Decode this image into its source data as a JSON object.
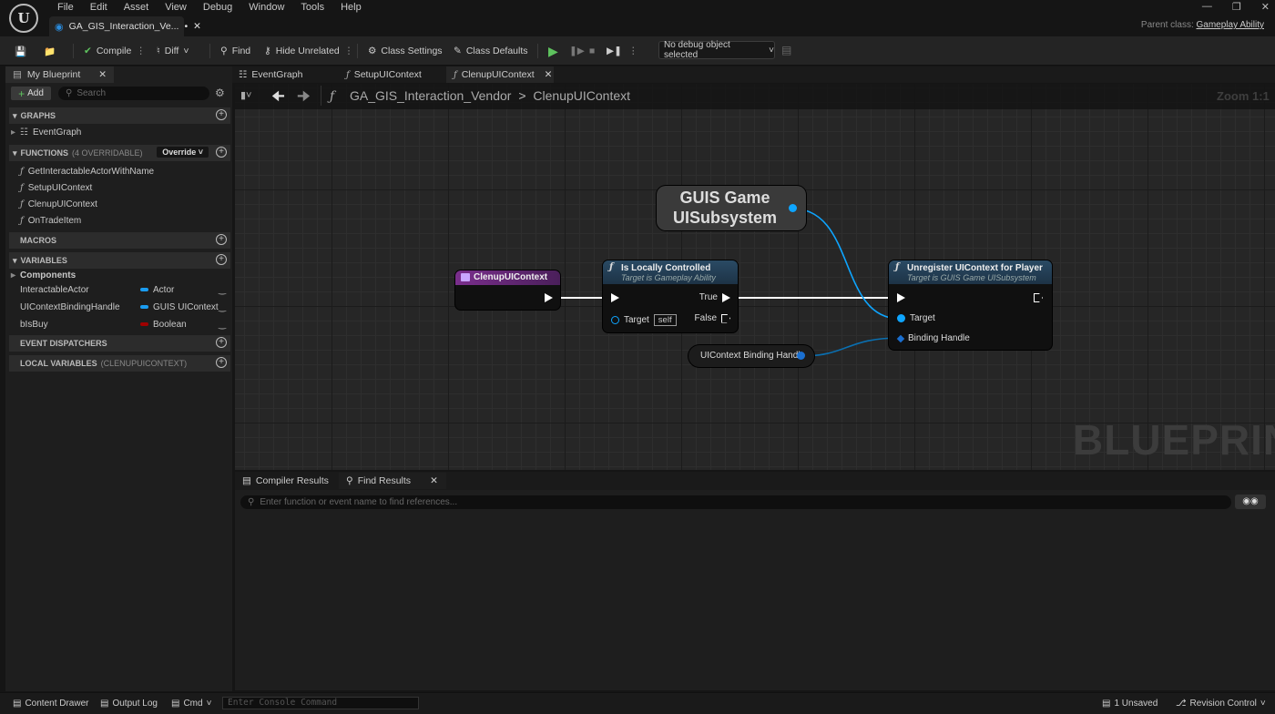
{
  "menu": [
    "File",
    "Edit",
    "Asset",
    "View",
    "Debug",
    "Window",
    "Tools",
    "Help"
  ],
  "doc_tab": "GA_GIS_Interaction_Ve...",
  "doc_tab_mark": "•",
  "parent_class_label": "Parent class:",
  "parent_class_value": "Gameplay Ability",
  "toolbar": {
    "compile": "Compile",
    "diff": "Diff",
    "find": "Find",
    "hide_unrelated": "Hide Unrelated",
    "class_settings": "Class Settings",
    "class_defaults": "Class Defaults",
    "debug_object": "No debug object selected"
  },
  "my_blueprint": {
    "tab": "My Blueprint",
    "add": "Add",
    "search_placeholder": "Search",
    "graphs": "GRAPHS",
    "event_graph": "EventGraph",
    "functions": "FUNCTIONS",
    "functions_count": "(4 OVERRIDABLE)",
    "override": "Override",
    "function_items": [
      "GetInteractableActorWithName",
      "SetupUIContext",
      "ClenupUIContext",
      "OnTradeItem"
    ],
    "macros": "MACROS",
    "variables": "VARIABLES",
    "components": "Components",
    "variable_items": [
      {
        "name": "InteractableActor",
        "type": "Actor",
        "color": "#1a9cf0"
      },
      {
        "name": "UIContextBindingHandle",
        "type": "GUIS UIContext",
        "color": "#1a9cf0"
      },
      {
        "name": "bIsBuy",
        "type": "Boolean",
        "color": "#a00000"
      }
    ],
    "event_dispatchers": "EVENT DISPATCHERS",
    "local_variables": "LOCAL VARIABLES",
    "local_variables_scope": "(CLENUPUICONTEXT)"
  },
  "graph_tabs": [
    "EventGraph",
    "SetupUIContext",
    "ClenupUIContext"
  ],
  "breadcrumb": {
    "root": "GA_GIS_Interaction_Vendor",
    "separator": ">",
    "current": "ClenupUIContext"
  },
  "zoom": "Zoom 1:1",
  "watermark": "BLUEPRINT",
  "nodes": {
    "entry": {
      "title": "ClenupUIContext"
    },
    "subsystem": {
      "title_line1": "GUIS Game",
      "title_line2": "UISubsystem"
    },
    "locally": {
      "title": "Is Locally Controlled",
      "subtitle": "Target is Gameplay Ability",
      "true": "True",
      "false": "False",
      "target": "Target",
      "self": "self"
    },
    "unregister": {
      "title": "Unregister UIContext for Player",
      "subtitle": "Target is GUIS Game UISubsystem",
      "target": "Target",
      "binding": "Binding Handle"
    },
    "handle": {
      "title": "UIContext Binding Handle"
    }
  },
  "bottom_tabs": [
    "Compiler Results",
    "Find Results"
  ],
  "find_placeholder": "Enter function or event name to find references...",
  "status": {
    "content_drawer": "Content Drawer",
    "output_log": "Output Log",
    "cmd": "Cmd",
    "console_placeholder": "Enter Console Command",
    "unsaved": "1 Unsaved",
    "revision": "Revision Control"
  },
  "colors": {
    "entry_header": "#7a2e8c",
    "call_header": "#2a4a64",
    "exec_wire": "#ffffff",
    "object_wire": "#0ea5ff"
  }
}
